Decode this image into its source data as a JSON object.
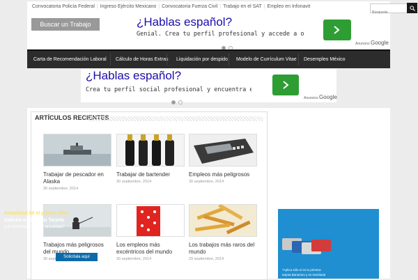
{
  "topbar": {
    "links": [
      "Convocatoria Policía Federal",
      "Ingreso Ejército Mexicano",
      "Convocatoria Fuerza Civil",
      "Trabajo en el SAT",
      "Empleo en Infonavit"
    ],
    "search_placeholder": "Búsqueda"
  },
  "header": {
    "job_button": "Buscar un Trabajo"
  },
  "ad1": {
    "title": "¿Hablas español?",
    "subtitle": "Genial. Crea tu perfil profesional y accede a ol",
    "label": "Anuncios",
    "brand": "Google"
  },
  "nav": {
    "items": [
      "Carta de Recomendación Laboral",
      "Cálculo de Horas Extras",
      "Liquidación por despido",
      "Modelo de Currículum Vitae",
      "Desempleo México"
    ]
  },
  "ad2": {
    "title": "¿Hablas español?",
    "subtitle": "Crea tu perfil social profesional y encuentra en",
    "label": "Anuncios",
    "brand": "Google"
  },
  "recent": {
    "heading": "ARTÍCULOS RECIENTES",
    "articles": [
      {
        "title": "Trabajar de pescador en Alaska",
        "date": "30 septiembre, 2014",
        "image": "ship-in-fog"
      },
      {
        "title": "Trabajar de bartender",
        "date": "30 septiembre, 2014",
        "image": "beer-bottles"
      },
      {
        "title": "Empleos más peligrosos",
        "date": "30 septiembre, 2014",
        "image": "cassette-recorder"
      },
      {
        "title": "Trabajos más peligrosos del mundo",
        "date": "30 septiembre, 2014",
        "image": "ice-fisherman"
      },
      {
        "title": "Los empleos más excéntricos del mundo",
        "date": "30 septiembre, 2014",
        "image": "red-dice"
      },
      {
        "title": "Los trabajos más raros del mundo",
        "date": "29 septiembre, 2014",
        "image": "french-fries"
      }
    ]
  },
  "promo": {
    "line1": "Anualidad $0 el primer año*",
    "line2": "Solicita en línea tu Tarjeta",
    "line3": "y te bonificamos la 1ª anualidad*",
    "cta": "Solicítala aquí",
    "fine1": "*Aplica sólo si es tu primera",
    "fine2": "tarjeta Banamex y es tramitada"
  }
}
